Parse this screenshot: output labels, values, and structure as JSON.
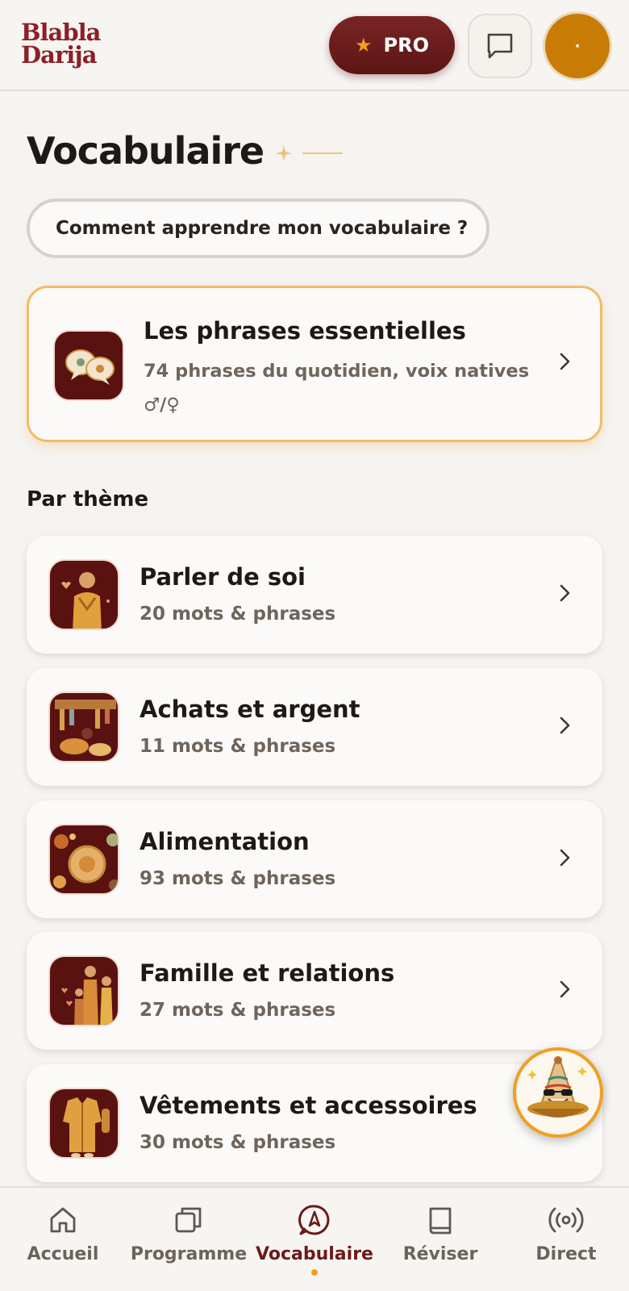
{
  "header": {
    "logo_line1": "Blabla",
    "logo_line2": "Darija",
    "pro_label": "PRO",
    "avatar_initial": "·"
  },
  "page": {
    "title": "Vocabulaire",
    "howto_label": "Comment apprendre mon vocabulaire ?"
  },
  "essentials": {
    "title": "Les phrases essentielles",
    "subtitle": "74 phrases du quotidien, voix natives ♂/♀"
  },
  "themes": {
    "section_title": "Par thème",
    "items": [
      {
        "title": "Parler de soi",
        "count": "20 mots & phrases",
        "icon": "person-icon"
      },
      {
        "title": "Achats et argent",
        "count": "11 mots & phrases",
        "icon": "market-icon"
      },
      {
        "title": "Alimentation",
        "count": "93 mots & phrases",
        "icon": "food-icon"
      },
      {
        "title": "Famille et relations",
        "count": "27 mots & phrases",
        "icon": "family-icon"
      },
      {
        "title": "Vêtements et accessoires",
        "count": "30 mots & phrases",
        "icon": "clothes-icon"
      }
    ]
  },
  "nav": {
    "items": [
      {
        "label": "Accueil",
        "icon": "home-icon"
      },
      {
        "label": "Programme",
        "icon": "layers-icon"
      },
      {
        "label": "Vocabulaire",
        "icon": "compass-icon",
        "active": true
      },
      {
        "label": "Réviser",
        "icon": "book-icon"
      },
      {
        "label": "Direct",
        "icon": "broadcast-icon"
      }
    ]
  },
  "colors": {
    "brand": "#8e1f26",
    "accent": "#f0a021",
    "background": "#f6f4f1"
  }
}
